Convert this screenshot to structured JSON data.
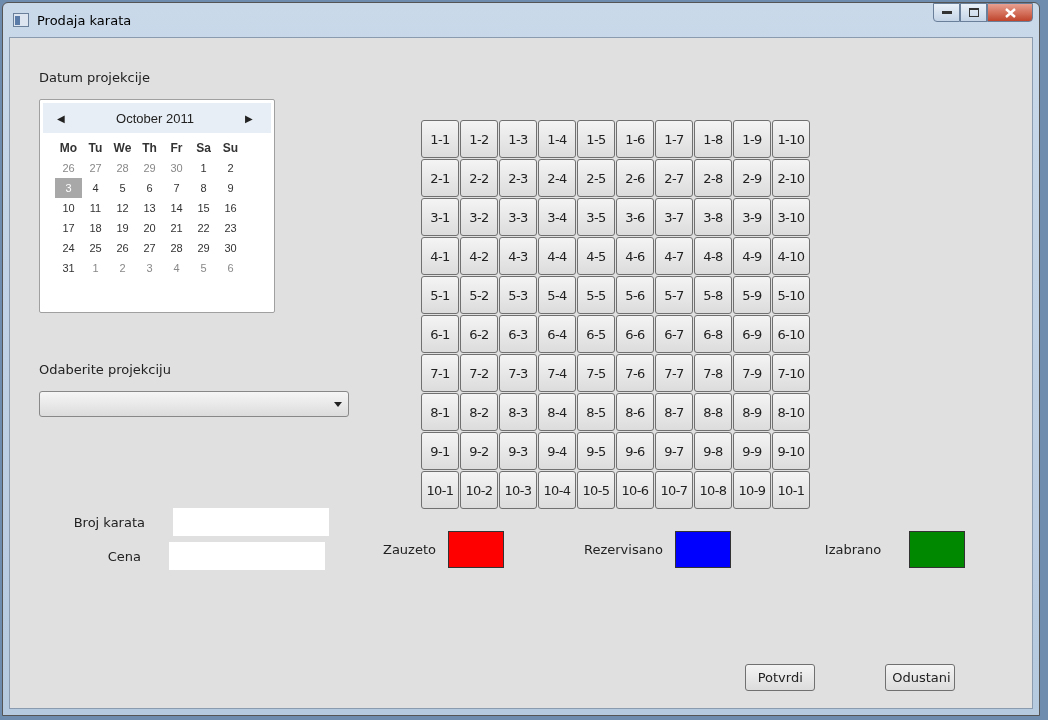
{
  "window": {
    "title": "Prodaja karata"
  },
  "date_label": "Datum projekcije",
  "calendar": {
    "prev": "◀",
    "month": "October 2011",
    "next": "▶",
    "weekdays": [
      "Mo",
      "Tu",
      "We",
      "Th",
      "Fr",
      "Sa",
      "Su"
    ],
    "weeks": [
      [
        {
          "day": "26",
          "in_month": false,
          "selected": false
        },
        {
          "day": "27",
          "in_month": false,
          "selected": false
        },
        {
          "day": "28",
          "in_month": false,
          "selected": false
        },
        {
          "day": "29",
          "in_month": false,
          "selected": false
        },
        {
          "day": "30",
          "in_month": false,
          "selected": false
        },
        {
          "day": "1",
          "in_month": true,
          "selected": false
        },
        {
          "day": "2",
          "in_month": true,
          "selected": false
        }
      ],
      [
        {
          "day": "3",
          "in_month": true,
          "selected": true
        },
        {
          "day": "4",
          "in_month": true,
          "selected": false
        },
        {
          "day": "5",
          "in_month": true,
          "selected": false
        },
        {
          "day": "6",
          "in_month": true,
          "selected": false
        },
        {
          "day": "7",
          "in_month": true,
          "selected": false
        },
        {
          "day": "8",
          "in_month": true,
          "selected": false
        },
        {
          "day": "9",
          "in_month": true,
          "selected": false
        }
      ],
      [
        {
          "day": "10",
          "in_month": true,
          "selected": false
        },
        {
          "day": "11",
          "in_month": true,
          "selected": false
        },
        {
          "day": "12",
          "in_month": true,
          "selected": false
        },
        {
          "day": "13",
          "in_month": true,
          "selected": false
        },
        {
          "day": "14",
          "in_month": true,
          "selected": false
        },
        {
          "day": "15",
          "in_month": true,
          "selected": false
        },
        {
          "day": "16",
          "in_month": true,
          "selected": false
        }
      ],
      [
        {
          "day": "17",
          "in_month": true,
          "selected": false
        },
        {
          "day": "18",
          "in_month": true,
          "selected": false
        },
        {
          "day": "19",
          "in_month": true,
          "selected": false
        },
        {
          "day": "20",
          "in_month": true,
          "selected": false
        },
        {
          "day": "21",
          "in_month": true,
          "selected": false
        },
        {
          "day": "22",
          "in_month": true,
          "selected": false
        },
        {
          "day": "23",
          "in_month": true,
          "selected": false
        }
      ],
      [
        {
          "day": "24",
          "in_month": true,
          "selected": false
        },
        {
          "day": "25",
          "in_month": true,
          "selected": false
        },
        {
          "day": "26",
          "in_month": true,
          "selected": false
        },
        {
          "day": "27",
          "in_month": true,
          "selected": false
        },
        {
          "day": "28",
          "in_month": true,
          "selected": false
        },
        {
          "day": "29",
          "in_month": true,
          "selected": false
        },
        {
          "day": "30",
          "in_month": true,
          "selected": false
        }
      ],
      [
        {
          "day": "31",
          "in_month": true,
          "selected": false
        },
        {
          "day": "1",
          "in_month": false,
          "selected": false
        },
        {
          "day": "2",
          "in_month": false,
          "selected": false
        },
        {
          "day": "3",
          "in_month": false,
          "selected": false
        },
        {
          "day": "4",
          "in_month": false,
          "selected": false
        },
        {
          "day": "5",
          "in_month": false,
          "selected": false
        },
        {
          "day": "6",
          "in_month": false,
          "selected": false
        }
      ]
    ]
  },
  "projection_label": "Odaberite projekciju",
  "fields": [
    {
      "label": "Broj karata"
    },
    {
      "label": "Cena"
    }
  ],
  "seats": [
    [
      "1-1",
      "1-2",
      "1-3",
      "1-4",
      "1-5",
      "1-6",
      "1-7",
      "1-8",
      "1-9",
      "1-10"
    ],
    [
      "2-1",
      "2-2",
      "2-3",
      "2-4",
      "2-5",
      "2-6",
      "2-7",
      "2-8",
      "2-9",
      "2-10"
    ],
    [
      "3-1",
      "3-2",
      "3-3",
      "3-4",
      "3-5",
      "3-6",
      "3-7",
      "3-8",
      "3-9",
      "3-10"
    ],
    [
      "4-1",
      "4-2",
      "4-3",
      "4-4",
      "4-5",
      "4-6",
      "4-7",
      "4-8",
      "4-9",
      "4-10"
    ],
    [
      "5-1",
      "5-2",
      "5-3",
      "5-4",
      "5-5",
      "5-6",
      "5-7",
      "5-8",
      "5-9",
      "5-10"
    ],
    [
      "6-1",
      "6-2",
      "6-3",
      "6-4",
      "6-5",
      "6-6",
      "6-7",
      "6-8",
      "6-9",
      "6-10"
    ],
    [
      "7-1",
      "7-2",
      "7-3",
      "7-4",
      "7-5",
      "7-6",
      "7-7",
      "7-8",
      "7-9",
      "7-10"
    ],
    [
      "8-1",
      "8-2",
      "8-3",
      "8-4",
      "8-5",
      "8-6",
      "8-7",
      "8-8",
      "8-9",
      "8-10"
    ],
    [
      "9-1",
      "9-2",
      "9-3",
      "9-4",
      "9-5",
      "9-6",
      "9-7",
      "9-8",
      "9-9",
      "9-10"
    ],
    [
      "10-1",
      "10-2",
      "10-3",
      "10-4",
      "10-5",
      "10-6",
      "10-7",
      "10-8",
      "10-9",
      "10-1"
    ]
  ],
  "legend": [
    {
      "label": "Zauzeto",
      "color": "#ff0000"
    },
    {
      "label": "Rezervisano",
      "color": "#0000ff"
    },
    {
      "label": "Izabrano",
      "color": "#008800"
    }
  ],
  "buttons": [
    "Potvrdi",
    "Odustani"
  ]
}
